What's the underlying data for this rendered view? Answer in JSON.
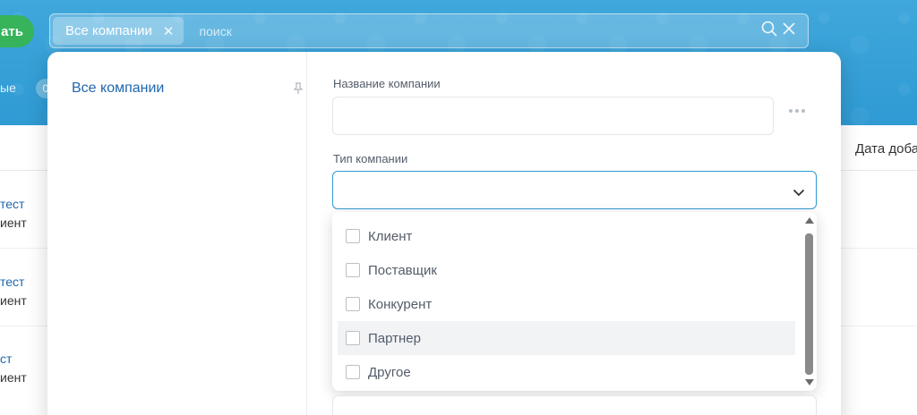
{
  "header": {
    "create_button_label": "ать",
    "filter_label": "ые",
    "filter_counter": "0"
  },
  "search": {
    "chip_label": "Все компании",
    "placeholder": "поиск"
  },
  "table": {
    "column_header": "Дата доба",
    "rows": [
      {
        "name": "тест",
        "type": "иент"
      },
      {
        "name": "тест",
        "type": "иент"
      },
      {
        "name": "ст",
        "type": "иент"
      }
    ]
  },
  "panel": {
    "preset_label": "Все компании",
    "company_name_label": "Название компании",
    "company_type_label": "Тип компании",
    "company_type_value": "",
    "options": [
      "Клиент",
      "Поставщик",
      "Конкурент",
      "Партнер",
      "Другое"
    ]
  },
  "colors": {
    "accent": "#2f9ad3",
    "link": "#2067b0",
    "green": "#36b35b"
  }
}
